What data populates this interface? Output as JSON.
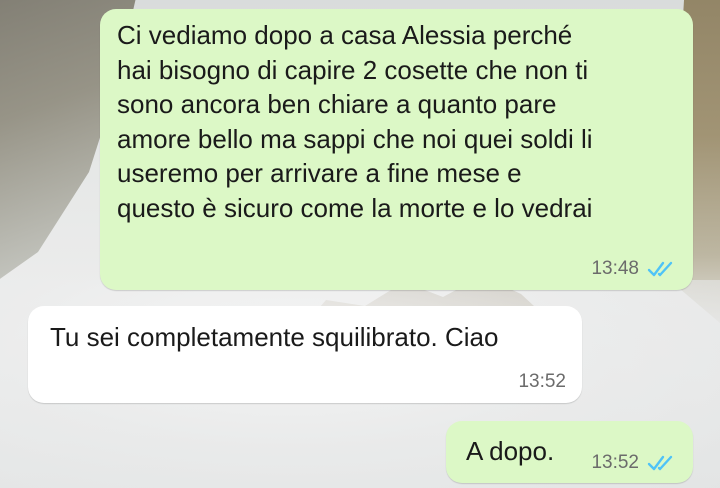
{
  "messages": [
    {
      "direction": "outgoing",
      "lines": [
        "Ci vediamo dopo a casa Alessia perché",
        "hai bisogno di capire 2 cosette che non ti",
        "sono ancora ben chiare a quanto pare",
        "amore bello ma sappi che noi quei soldi li",
        "useremo per arrivare a fine mese e",
        "questo è sicuro come la morte e lo vedrai"
      ],
      "time": "13:48",
      "status": "read",
      "status_icon": "double-check-icon"
    },
    {
      "direction": "incoming",
      "lines": [
        "Tu sei completamente squilibrato. Ciao"
      ],
      "time": "13:52"
    },
    {
      "direction": "outgoing",
      "lines": [
        "A dopo."
      ],
      "time": "13:52",
      "status": "read",
      "status_icon": "double-check-icon"
    }
  ],
  "colors": {
    "outgoing_bubble": "#dcf8c6",
    "incoming_bubble": "#ffffff",
    "read_ticks": "#4fc3f7",
    "timestamp": "#6b6b6b"
  }
}
